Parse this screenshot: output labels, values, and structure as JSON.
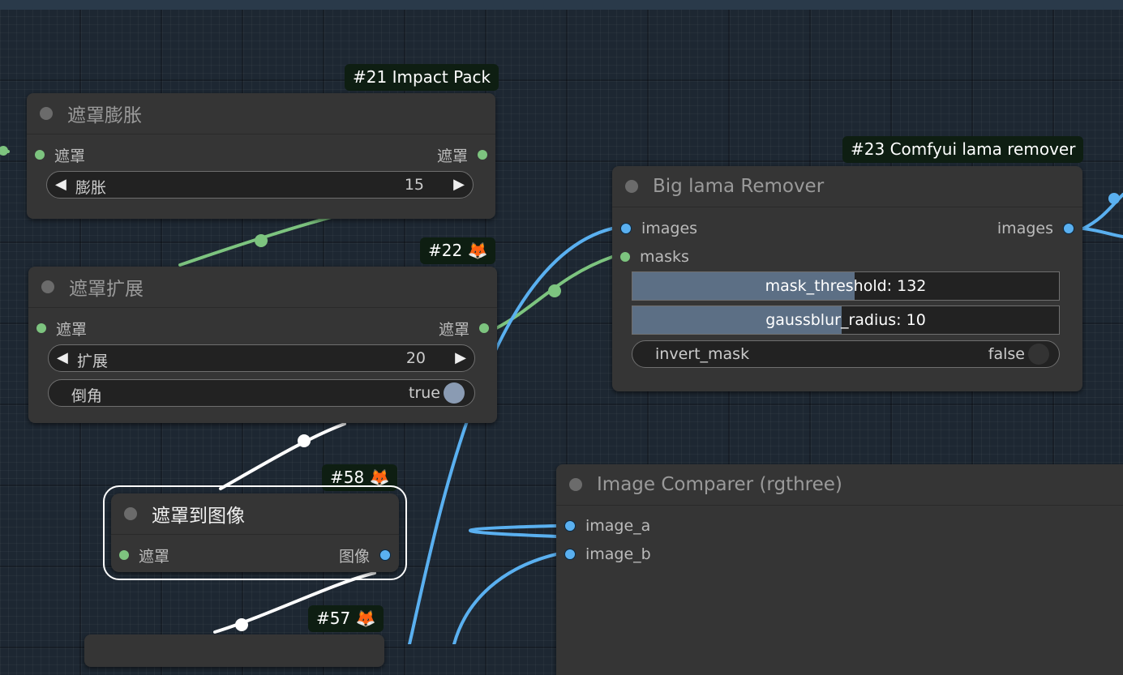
{
  "nodes": {
    "n21": {
      "badge": "#21 Impact Pack",
      "title": "遮罩膨胀",
      "input": "遮罩",
      "output": "遮罩",
      "widget_label": "膨胀",
      "widget_value": "15"
    },
    "n22": {
      "badge": "#22 🦊",
      "title": "遮罩扩展",
      "input": "遮罩",
      "output": "遮罩",
      "widget_label": "扩展",
      "widget_value": "20",
      "toggle_label": "倒角",
      "toggle_value": "true"
    },
    "n23": {
      "badge": "#23 Comfyui lama remover",
      "title": "Big lama Remover",
      "inputs": [
        "images",
        "masks"
      ],
      "output": "images",
      "mask_threshold": "mask_threshold: 132",
      "mask_threshold_fraction": 0.52,
      "gaussblur_radius": "gaussblur_radius: 10",
      "gaussblur_fraction": 0.49,
      "toggle_label": "invert_mask",
      "toggle_value": "false"
    },
    "n58": {
      "badge": "#58 🦊",
      "title": "遮罩到图像",
      "input": "遮罩",
      "output": "图像"
    },
    "n57": {
      "badge": "#57 🦊"
    },
    "comparer": {
      "title": "Image Comparer (rgthree)",
      "inputs": [
        "image_a",
        "image_b"
      ]
    }
  },
  "colors": {
    "mask_link": "#7dc47f",
    "image_link": "#5ab0f0",
    "white_link": "#ffffff",
    "node_bg": "#353535",
    "badge_bg": "#0e1e12"
  }
}
